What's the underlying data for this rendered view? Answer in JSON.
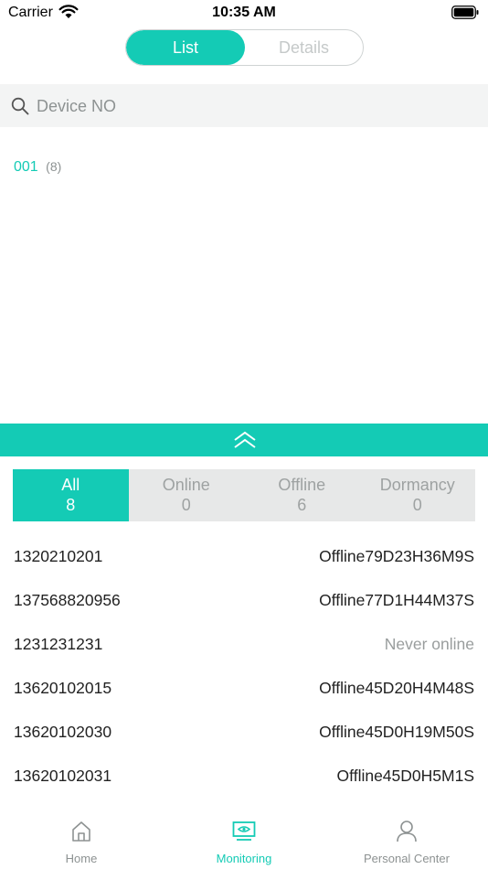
{
  "status_bar": {
    "carrier": "Carrier",
    "time": "10:35 AM"
  },
  "segment": {
    "list_label": "List",
    "details_label": "Details",
    "selected": "List"
  },
  "search": {
    "placeholder": "Device NO",
    "value": ""
  },
  "group": {
    "name": "001",
    "count": "(8)"
  },
  "filter_tabs": [
    {
      "label": "All",
      "count": "8",
      "active": true
    },
    {
      "label": "Online",
      "count": "0",
      "active": false
    },
    {
      "label": "Offline",
      "count": "6",
      "active": false
    },
    {
      "label": "Dormancy",
      "count": "0",
      "active": false
    }
  ],
  "devices": [
    {
      "id": "1320210201",
      "status": "Offline79D23H36M9S"
    },
    {
      "id": "137568820956",
      "status": "Offline77D1H44M37S"
    },
    {
      "id": "1231231231",
      "status": "Never online"
    },
    {
      "id": "13620102015",
      "status": "Offline45D20H4M48S"
    },
    {
      "id": "13620102030",
      "status": "Offline45D0H19M50S"
    },
    {
      "id": "13620102031",
      "status": "Offline45D0H5M1S"
    }
  ],
  "tab_bar": [
    {
      "label": "Home",
      "icon": "home-icon",
      "active": false
    },
    {
      "label": "Monitoring",
      "icon": "monitor-icon",
      "active": true
    },
    {
      "label": "Personal Center",
      "icon": "person-icon",
      "active": false
    }
  ],
  "colors": {
    "accent": "#14cbb5",
    "muted_text": "#8d9292",
    "tab_background": "#e7e8e8"
  }
}
